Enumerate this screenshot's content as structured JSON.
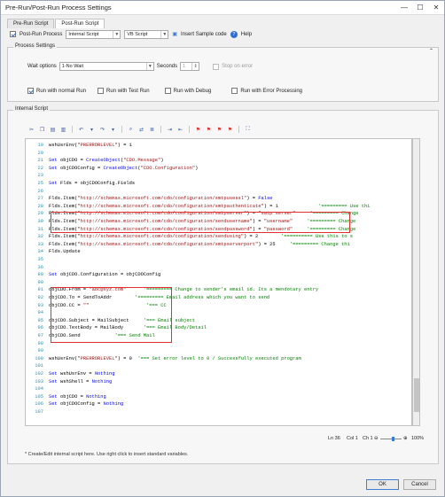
{
  "window": {
    "title": "Pre-Run/Post-Run Process Settings",
    "minimize": "—",
    "maximize": "☐",
    "close": "✕"
  },
  "tabs": [
    {
      "label": "Pre-Run Script"
    },
    {
      "label": "Post-Run Script"
    }
  ],
  "top": {
    "post_run_label": "Post-Run Process",
    "script_type": "Internal Script",
    "language": "VB Script",
    "insert_sample": "Insert Sample code",
    "help": "Help"
  },
  "process_settings": {
    "title": "Process Settings",
    "wait_label": "Wait options",
    "wait_value": "1-No Wait",
    "seconds_label": "Seconds",
    "seconds_value": "1",
    "stop_on_error": "Stop on error",
    "run_normal": "Run with normal Run",
    "run_test": "Run with Test Run",
    "run_debug": "Run with Debug",
    "run_error": "Run with Error Processing"
  },
  "internal_script": {
    "title": "Internal Script"
  },
  "code_lines": [
    {
      "n": "19",
      "t": "wshUsrEnv(\"PRERRORLEVEL\") = 1",
      "k": "plain"
    },
    {
      "n": "20",
      "t": "",
      "k": "plain"
    },
    {
      "n": "21",
      "t": "Set objCDO = CreateObject(\"CDO.Message\")",
      "k": "plain"
    },
    {
      "n": "22",
      "t": "Set objCDOConfig = CreateObject(\"CDO.Configuration\")",
      "k": "plain"
    },
    {
      "n": "23",
      "t": "",
      "k": "plain"
    },
    {
      "n": "25",
      "t": "Set Flds = objCDOConfig.Fields",
      "k": "plain"
    },
    {
      "n": "26",
      "t": "",
      "k": "plain"
    },
    {
      "n": "27",
      "t": "Flds.Item(\"http://schemas.microsoft.com/cdo/configuration/smtpusessl\") = False",
      "k": "plain"
    },
    {
      "n": "28",
      "t": "Flds.Item(\"http://schemas.microsoft.com/cdo/configuration/smtpauthenticate\") = 1              '========= Use thi",
      "k": "plain"
    },
    {
      "n": "29",
      "t": "Flds.Item(\"http://schemas.microsoft.com/cdo/configuration/smtpserver\") = \"smtp server\"     '========= Change",
      "k": "plain"
    },
    {
      "n": "30",
      "t": "Flds.Item(\"http://schemas.microsoft.com/cdo/configuration/sendusername\") = \"username\"     '========= Change",
      "k": "plain"
    },
    {
      "n": "31",
      "t": "Flds.Item(\"http://schemas.microsoft.com/cdo/configuration/sendpassword\") = \"password\"     '========= Change",
      "k": "plain"
    },
    {
      "n": "32",
      "t": "Flds.Item(\"http://schemas.microsoft.com/cdo/configuration/sendusing\") = 2        '========== Use this to s",
      "k": "plain"
    },
    {
      "n": "33",
      "t": "Flds.Item(\"http://schemas.microsoft.com/cdo/configuration/smtpserverport\") = 25     '========= Change thi",
      "k": "plain"
    },
    {
      "n": "34",
      "t": "Flds.Update",
      "k": "plain"
    },
    {
      "n": "35",
      "t": "",
      "k": "plain"
    },
    {
      "n": "36",
      "t": "",
      "k": "plain"
    },
    {
      "n": "89",
      "t": "Set objCDO.Configuration = objCDOConfig",
      "k": "plain"
    },
    {
      "n": "90",
      "t": "",
      "k": "plain"
    },
    {
      "n": "91",
      "t": "objCDO.From = \"abc@xyz.com\"      '========= Change to sender's email id. Its a mendotary entry",
      "k": "plain"
    },
    {
      "n": "92",
      "t": "objCDO.To = SendToAddr        '========= Email address which you want to send",
      "k": "plain"
    },
    {
      "n": "93",
      "t": "objCDO.CC = \"\"                    '=== CC",
      "k": "plain"
    },
    {
      "n": "94",
      "t": "",
      "k": "plain"
    },
    {
      "n": "95",
      "t": "objCDO.Subject = MailSubject     '=== Email subject",
      "k": "plain"
    },
    {
      "n": "96",
      "t": "objCDO.TextBody = MailBody       '=== Email Body/Detail",
      "k": "plain"
    },
    {
      "n": "97",
      "t": "objCDO.Send            '=== Send Mail",
      "k": "plain"
    },
    {
      "n": "98",
      "t": "",
      "k": "plain"
    },
    {
      "n": "99",
      "t": "",
      "k": "plain"
    },
    {
      "n": "100",
      "t": "wshUsrEnv(\"PRERRORLEVEL\") = 0  '=== Set error level to 0 / Successfully executed program",
      "k": "plain"
    },
    {
      "n": "101",
      "t": "",
      "k": "plain"
    },
    {
      "n": "102",
      "t": "Set wshUsrEnv = Nothing",
      "k": "plain"
    },
    {
      "n": "103",
      "t": "Set wshShell = Nothing",
      "k": "plain"
    },
    {
      "n": "104",
      "t": "",
      "k": "plain"
    },
    {
      "n": "105",
      "t": "Set objCDO = Nothing",
      "k": "plain"
    },
    {
      "n": "106",
      "t": "Set objCDOConfig = Nothing",
      "k": "plain"
    },
    {
      "n": "107",
      "t": "",
      "k": "plain"
    }
  ],
  "status": {
    "ln": "Ln 36",
    "col": "Col 1",
    "ch": "Ch 1",
    "zoom": "100%",
    "zoom_value": 0.6
  },
  "hint": "* Create/Edit internal script here. Use right click to insert standard variables.",
  "buttons": {
    "ok": "OK",
    "cancel": "Cancel"
  }
}
